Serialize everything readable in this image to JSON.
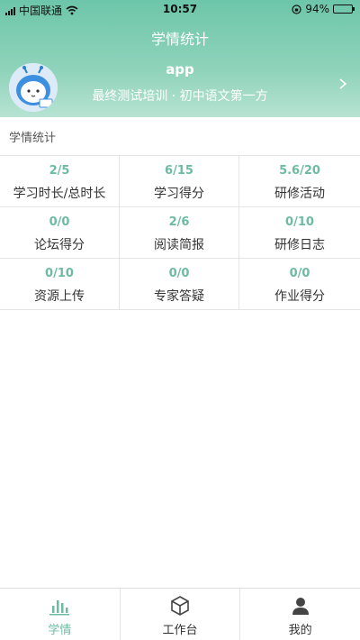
{
  "status_bar": {
    "carrier": "中国联通",
    "time": "10:57",
    "battery_percent": "94%",
    "battery_level": 0.94
  },
  "header": {
    "title": "学情统计",
    "username": "app",
    "course": "最终测试培训 · 初中语文第一方"
  },
  "section": {
    "label": "学情统计"
  },
  "stats": [
    {
      "value": "2/5",
      "label": "学习时长/总时长"
    },
    {
      "value": "6/15",
      "label": "学习得分"
    },
    {
      "value": "5.6/20",
      "label": "研修活动"
    },
    {
      "value": "0/0",
      "label": "论坛得分"
    },
    {
      "value": "2/6",
      "label": "阅读简报"
    },
    {
      "value": "0/10",
      "label": "研修日志"
    },
    {
      "value": "0/10",
      "label": "资源上传"
    },
    {
      "value": "0/0",
      "label": "专家答疑"
    },
    {
      "value": "0/0",
      "label": "作业得分"
    }
  ],
  "tabbar": {
    "items": [
      {
        "label": "学情",
        "icon": "bar-chart-icon",
        "active": true
      },
      {
        "label": "工作台",
        "icon": "box-icon",
        "active": false
      },
      {
        "label": "我的",
        "icon": "person-icon",
        "active": false
      }
    ]
  },
  "colors": {
    "accent": "#6dbba0",
    "header_top": "#6dc6a9",
    "header_bottom": "#b7e3d3"
  }
}
